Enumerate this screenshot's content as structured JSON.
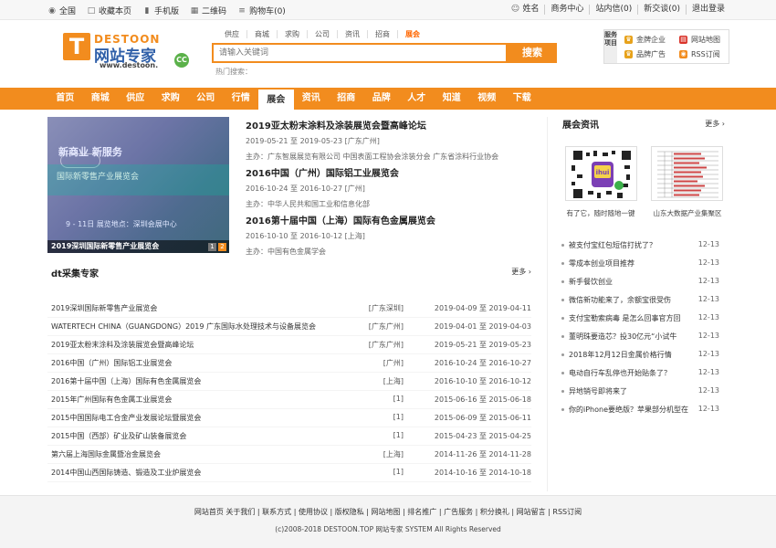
{
  "topbar": {
    "left": [
      {
        "icon": "location-icon",
        "label": "全国"
      },
      {
        "icon": "bookmark-icon",
        "label": "收藏本页"
      },
      {
        "icon": "mobile-icon",
        "label": "手机版"
      },
      {
        "icon": "qrcode-icon",
        "label": "二维码"
      },
      {
        "icon": "cart-icon",
        "label": "购物车(0)"
      }
    ],
    "right": [
      {
        "label": "姓名"
      },
      {
        "label": "商务中心"
      },
      {
        "label": "站内信(0)"
      },
      {
        "label": "新交谈(0)"
      },
      {
        "label": "退出登录"
      }
    ]
  },
  "logo": {
    "top": "DESTOON",
    "main": "网站专家",
    "url": "www.destoon.",
    "cc": "CC"
  },
  "search": {
    "tabs": [
      "供应",
      "商城",
      "求购",
      "公司",
      "资讯",
      "招商",
      "展会"
    ],
    "active": "展会",
    "placeholder": "请输入关键词",
    "button": "搜索",
    "hot": "热门搜索："
  },
  "service": {
    "label": "服务项目",
    "items": [
      "金牌企业",
      "网站地图",
      "品牌广告",
      "RSS订阅"
    ]
  },
  "nav": {
    "items": [
      "首页",
      "商城",
      "供应",
      "求购",
      "公司",
      "行情",
      "展会",
      "资讯",
      "招商",
      "品牌",
      "人才",
      "知道",
      "视频",
      "下载"
    ],
    "active": "展会"
  },
  "banner": {
    "caption": "2019深圳国际新零售产业展览会",
    "pages": [
      "1",
      "2"
    ],
    "text1": "新商业 新服务",
    "text2": "国际新零售产业展览会",
    "text3": "9 - 11日  展览地点：深圳会展中心"
  },
  "featured": [
    {
      "title": "2019亚太粉末涂料及涂装展览会暨高峰论坛",
      "date": "2019-05-21 至 2019-05-23 [广东广州]",
      "host": "主办：广东智展展览有限公司 中国表面工程协会涂装分会 广东省涂料行业协会"
    },
    {
      "title": "2016中国（广州）国际铝工业展览会",
      "date": "2016-10-24 至 2016-10-27 [广州]",
      "host": "主办：中华人民共和国工业和信息化部"
    },
    {
      "title": "2016第十届中国（上海）国际有色金属展览会",
      "date": "2016-10-10 至 2016-10-12 [上海]",
      "host": "主办：中国有色金属学会"
    }
  ],
  "section": {
    "title": "dt采集专家",
    "more": "更多"
  },
  "list": [
    {
      "name": "2019深圳国际新零售产业展览会",
      "city": "[广东深圳]",
      "date": "2019-04-09 至 2019-04-11"
    },
    {
      "name": "WATERTECH CHINA（GUANGDONG）2019 广东国际水处理技术与设备展览会",
      "city": "[广东广州]",
      "date": "2019-04-01 至 2019-04-03"
    },
    {
      "name": "2019亚太粉末涂料及涂装展览会暨高峰论坛",
      "city": "[广东广州]",
      "date": "2019-05-21 至 2019-05-23"
    },
    {
      "name": "2016中国（广州）国际铝工业展览会",
      "city": "[广州]",
      "date": "2016-10-24 至 2016-10-27"
    },
    {
      "name": "2016第十届中国（上海）国际有色金属展览会",
      "city": "[上海]",
      "date": "2016-10-10 至 2016-10-12"
    },
    {
      "name": "2015年广州国际有色金属工业展览会",
      "city": "[1]",
      "date": "2015-06-16 至 2015-06-18"
    },
    {
      "name": "2015中国国际电工合金产业发展论坛暨展览会",
      "city": "[1]",
      "date": "2015-06-09 至 2015-06-11"
    },
    {
      "name": "2015中国（西部）矿业及矿山装备展览会",
      "city": "[1]",
      "date": "2015-04-23 至 2015-04-25"
    },
    {
      "name": "第六届上海国际金属暨冶金展览会",
      "city": "[上海]",
      "date": "2014-11-26 至 2014-11-28"
    },
    {
      "name": "2014中国山西国际铸造、锻造及工业炉展览会",
      "city": "[1]",
      "date": "2014-10-16 至 2014-10-18"
    }
  ],
  "side": {
    "title": "展会资讯",
    "more": "更多",
    "qr1_caption": "有了它，随时随地一键",
    "qr2_caption": "山东大数据产业集聚区",
    "qr_text": "ihui",
    "news": [
      {
        "title": "被支付宝红包短信打扰了？",
        "date": "12-13"
      },
      {
        "title": "零成本创业项目推荐",
        "date": "12-13"
      },
      {
        "title": "新手餐饮创业",
        "date": "12-13"
      },
      {
        "title": "微信新功能来了，余额宝很受伤",
        "date": "12-13"
      },
      {
        "title": "支付宝勒索病毒 是怎么回事官方回",
        "date": "12-13"
      },
      {
        "title": "董明珠要造芯？投30亿元“小试牛",
        "date": "12-13"
      },
      {
        "title": "2018年12月12日金属价格行情",
        "date": "12-13"
      },
      {
        "title": "电动自行车乱停也开始贴条了？",
        "date": "12-13"
      },
      {
        "title": "异地销号即将来了",
        "date": "12-13"
      },
      {
        "title": "你的iPhone要绝版？苹果部分机型在",
        "date": "12-13"
      }
    ]
  },
  "footer": {
    "links": [
      "网站首页",
      "关于我们",
      "联系方式",
      "使用协议",
      "版权隐私",
      "网站地图",
      "排名推广",
      "广告服务",
      "积分换礼",
      "网站留言",
      "RSS订阅"
    ],
    "copyright": "(c)2008-2018 DESTOON.TOP 网站专家 SYSTEM All Rights Reserved"
  },
  "colors": {
    "accent": "#f28c1e"
  }
}
